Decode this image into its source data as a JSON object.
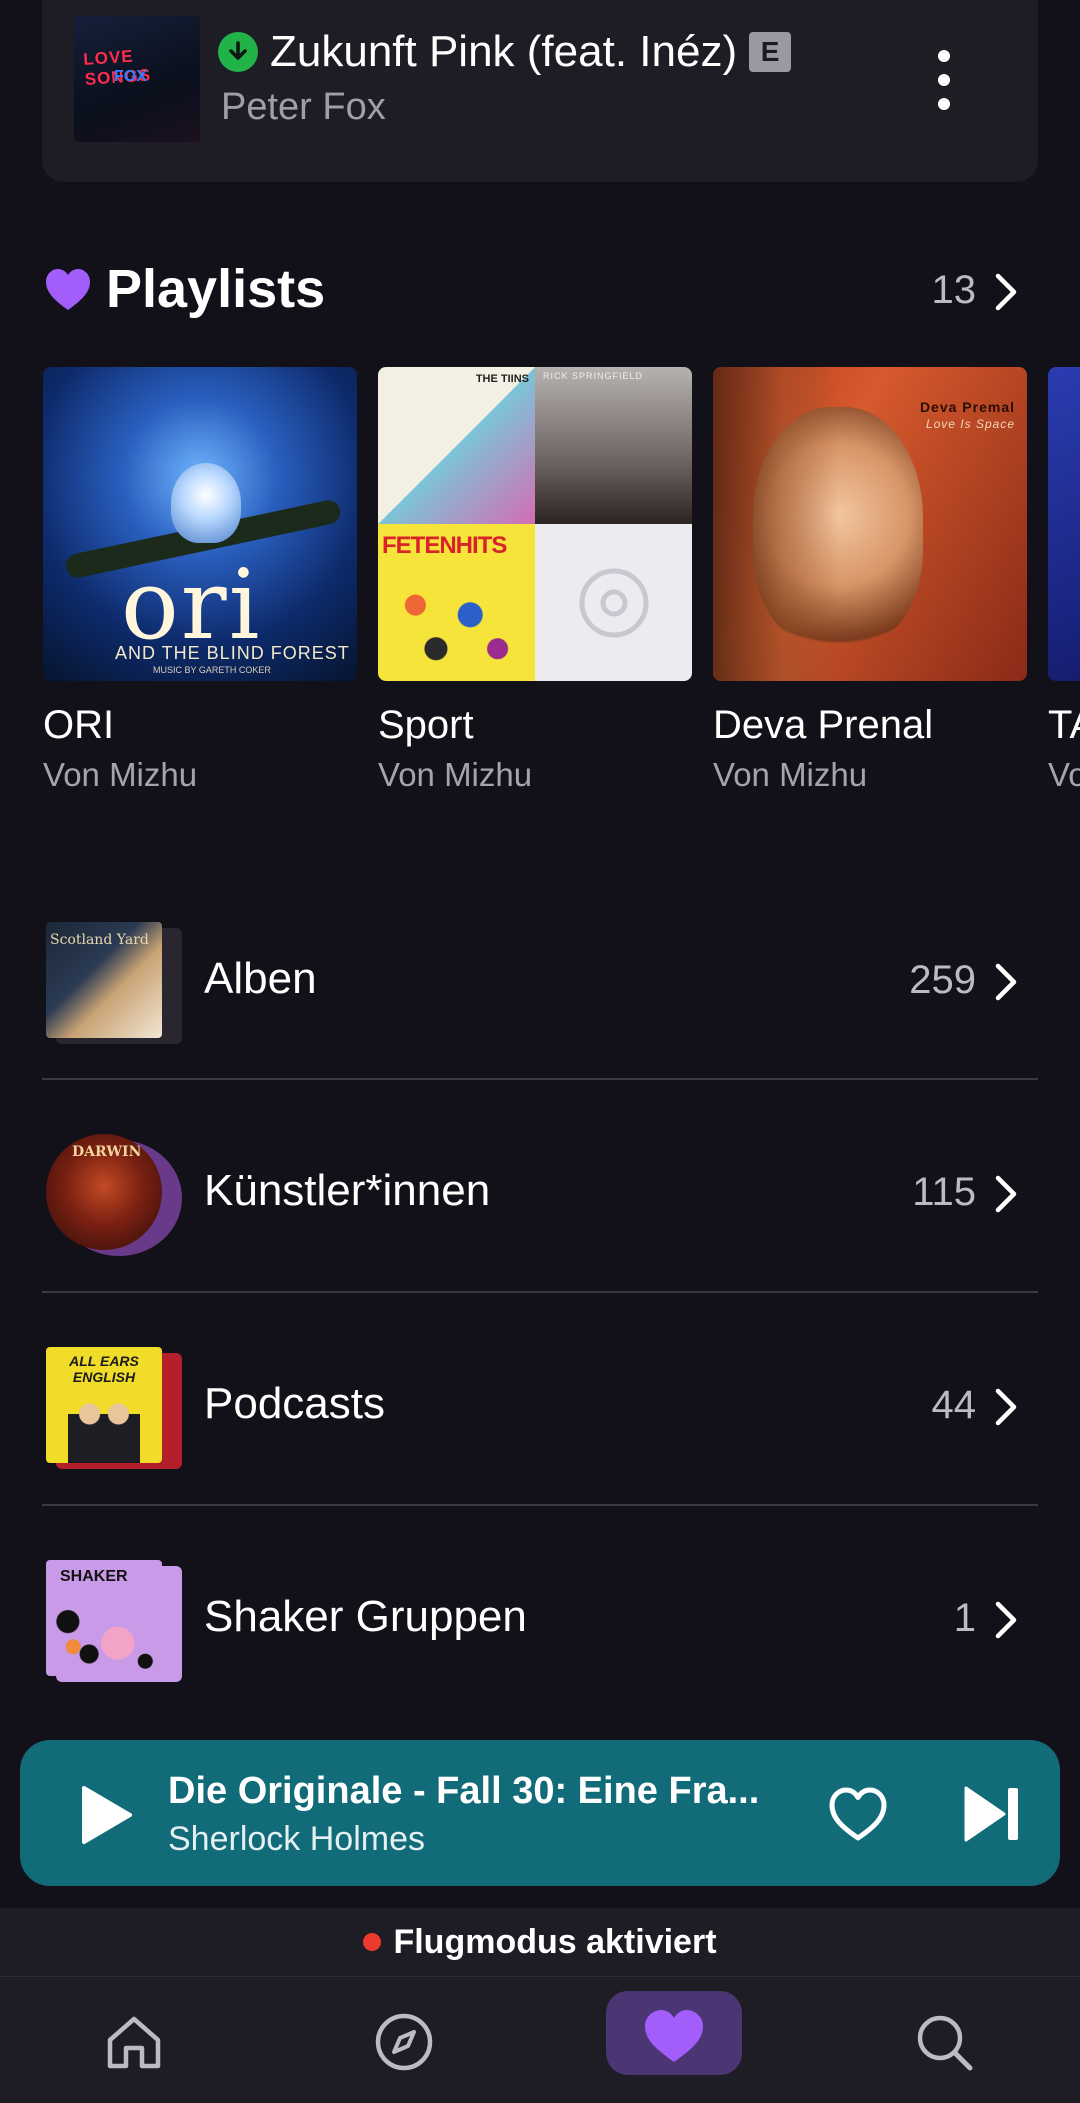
{
  "now_track": {
    "title": "Zukunft Pink (feat. Inéz)",
    "artist": "Peter Fox",
    "explicit_badge": "E",
    "cover_text_1": "LOVE SONGS",
    "cover_text_2": "FOX",
    "download_status": "downloaded"
  },
  "playlists": {
    "title": "Playlists",
    "count": "13",
    "items": [
      {
        "name": "ORI",
        "owner": "Von Mizhu",
        "cover_logo": "ori",
        "cover_sub": "AND THE BLIND FOREST",
        "cover_credit": "MUSIC BY GARETH COKER"
      },
      {
        "name": "Sport",
        "owner": "Von Mizhu",
        "cover_text_a": "THE TIINS",
        "cover_text_b": "RICK SPRINGFIELD",
        "cover_text_c": "FETENHITS"
      },
      {
        "name": "Deva Prenal",
        "owner": "Von Mizhu",
        "cover_text_a": "Deva Premal",
        "cover_text_b": "Love Is Space"
      },
      {
        "name": "TA",
        "owner": "Vo"
      }
    ]
  },
  "library": [
    {
      "label": "Alben",
      "count": "259",
      "cover_text": "Scotland Yard"
    },
    {
      "label": "Künstler*innen",
      "count": "115",
      "cover_text": "DARWIN"
    },
    {
      "label": "Podcasts",
      "count": "44",
      "cover_text": "ALL EARS ENGLISH"
    },
    {
      "label": "Shaker Gruppen",
      "count": "1",
      "cover_text": "SHAKER"
    }
  ],
  "mini_player": {
    "title": "Die Originale - Fall 30: Eine Fra...",
    "artist": "Sherlock Holmes",
    "background": "#126b78"
  },
  "status": {
    "text": "Flugmodus aktiviert"
  },
  "nav": {
    "items": [
      "home-icon",
      "explore-icon",
      "library-heart-icon",
      "search-icon"
    ],
    "active": "library-heart-icon"
  },
  "colors": {
    "accent": "#a35dfb",
    "background": "#121018",
    "card": "#1e1c24",
    "download_green": "#21b34a",
    "alert_red": "#ec3a2e"
  }
}
